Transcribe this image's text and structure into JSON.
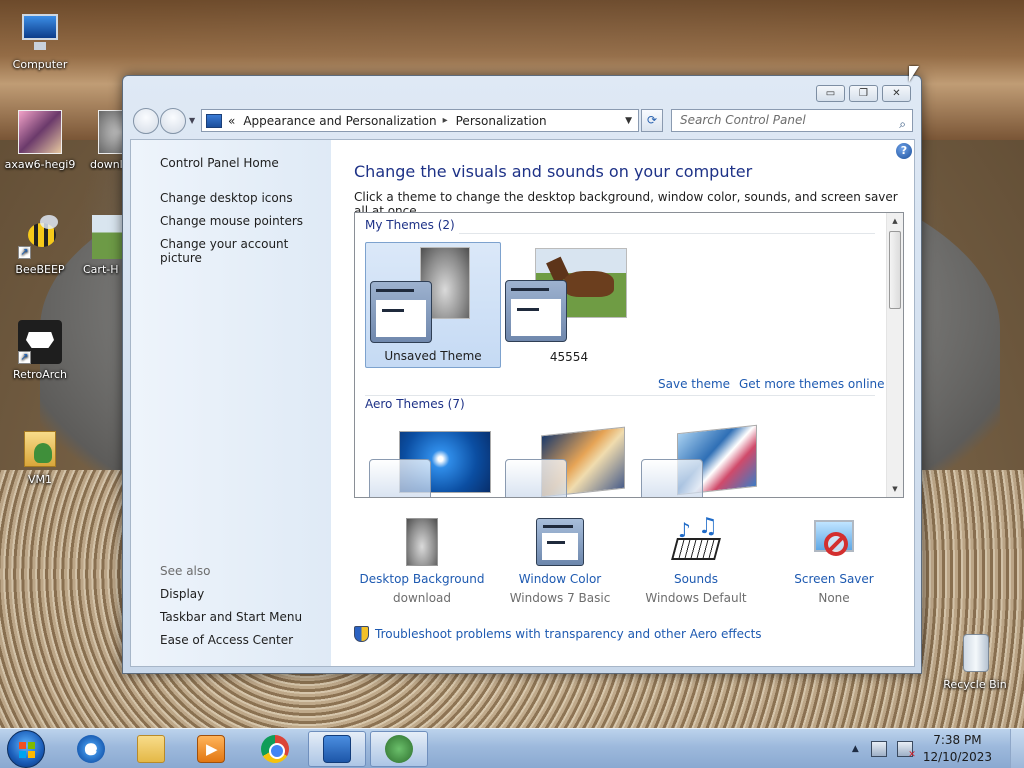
{
  "desktop": {
    "icons": [
      {
        "label": "Computer"
      },
      {
        "label": "axaw6-hegi9"
      },
      {
        "label": "downl"
      },
      {
        "label": "BeeBEEP"
      },
      {
        "label": "Cart-H"
      },
      {
        "label": "RetroArch"
      },
      {
        "label": "VM1"
      },
      {
        "label": "Recycle Bin"
      }
    ]
  },
  "window": {
    "controls": {
      "minimize": "▭",
      "maximize": "❐",
      "close": "✕"
    },
    "address": {
      "overflow": "«",
      "crumbs": [
        "Appearance and Personalization",
        "Personalization"
      ],
      "separator": "▸"
    },
    "search": {
      "placeholder": "Search Control Panel"
    }
  },
  "left_pane": {
    "home": "Control Panel Home",
    "links": [
      "Change desktop icons",
      "Change mouse pointers",
      "Change your account picture"
    ],
    "see_also_label": "See also",
    "see_also": [
      "Display",
      "Taskbar and Start Menu",
      "Ease of Access Center"
    ]
  },
  "main": {
    "title": "Change the visuals and sounds on your computer",
    "description": "Click a theme to change the desktop background, window color, sounds, and screen saver all at once.",
    "my_themes": {
      "header": "My Themes (2)",
      "items": [
        {
          "name": "Unsaved Theme",
          "selected": true
        },
        {
          "name": "45554",
          "selected": false
        }
      ],
      "save_link": "Save theme",
      "more_link": "Get more themes online"
    },
    "aero_themes": {
      "header": "Aero Themes (7)"
    },
    "settings": [
      {
        "name": "Desktop Background",
        "value": "download",
        "icon": "wallpaper-icon"
      },
      {
        "name": "Window Color",
        "value": "Windows 7 Basic",
        "icon": "window-color-icon"
      },
      {
        "name": "Sounds",
        "value": "Windows Default",
        "icon": "sounds-icon"
      },
      {
        "name": "Screen Saver",
        "value": "None",
        "icon": "screen-saver-icon"
      }
    ],
    "troubleshoot": "Troubleshoot problems with transparency and other Aero effects"
  },
  "taskbar": {
    "clock_time": "7:38 PM",
    "clock_date": "12/10/2023",
    "buttons": [
      "internet-explorer",
      "file-explorer",
      "media-player",
      "chrome",
      "control-panel",
      "windows-orb"
    ]
  }
}
